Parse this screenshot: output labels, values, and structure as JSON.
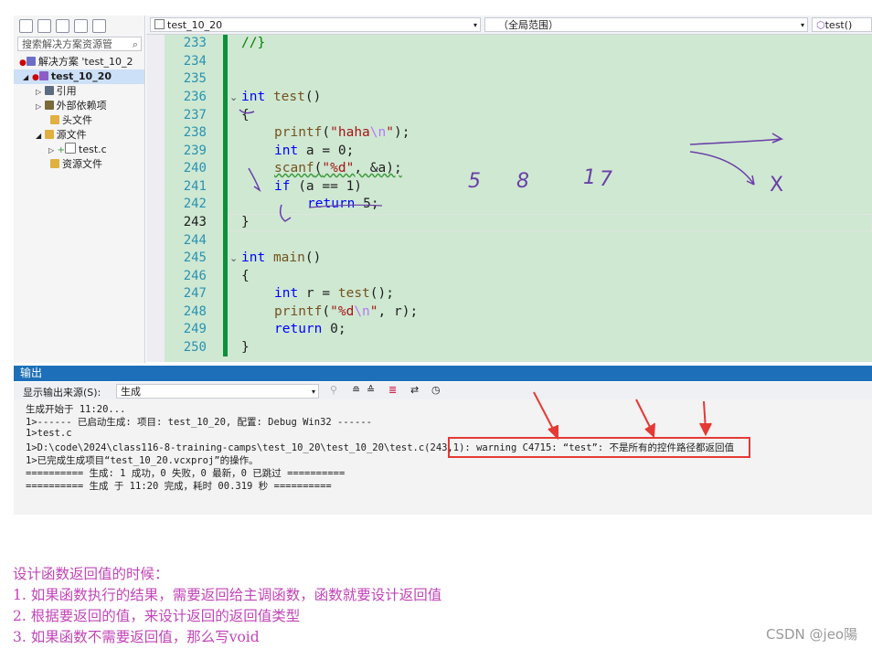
{
  "solution_explorer": {
    "search_placeholder": "搜索解决方案资源管",
    "tree": [
      {
        "label": "解决方案 'test_10_2",
        "indent": 1
      },
      {
        "label": "test_10_20",
        "indent": 1,
        "selected": true
      },
      {
        "label": "引用",
        "indent": 3
      },
      {
        "label": "外部依赖项",
        "indent": 3
      },
      {
        "label": "头文件",
        "indent": 3
      },
      {
        "label": "源文件",
        "indent": 3
      },
      {
        "label": "test.c",
        "indent": 5
      },
      {
        "label": "资源文件",
        "indent": 3
      }
    ]
  },
  "editor": {
    "file_dropdown": "test_10_20",
    "scope_dropdown": "（全局范围）",
    "member_dropdown": "test()",
    "line_numbers": [
      "233",
      "234",
      "235",
      "236",
      "237",
      "238",
      "239",
      "240",
      "241",
      "242",
      "243",
      "244",
      "245",
      "246",
      "247",
      "248",
      "249",
      "250"
    ],
    "current_line": "243",
    "code": {
      "l233": "//}",
      "l236_kw": "int",
      "l236_fn": "test",
      "l236_rest": "()",
      "l237": "{",
      "l238_fn": "printf",
      "l238_open": "(",
      "l238_str": "\"haha",
      "l238_esc": "\\n",
      "l238_str2": "\"",
      "l238_close": ");",
      "l239_kw": "int",
      "l239_rest": " a = 0;",
      "l240_fn": "scanf",
      "l240_open": "(",
      "l240_str": "\"%d\"",
      "l240_rest": ", &a);",
      "l241_kw": "if",
      "l241_rest": " (a == 1)",
      "l242_kw": "return",
      "l242_rest": " 5;",
      "l243": "}",
      "l245_kw": "int",
      "l245_fn": "main",
      "l245_rest": "()",
      "l246": "{",
      "l247_kw": "int",
      "l247_mid": " r = ",
      "l247_fn": "test",
      "l247_rest": "();",
      "l248_fn": "printf",
      "l248_open": "(",
      "l248_str": "\"%d",
      "l248_esc": "\\n",
      "l248_str2": "\"",
      "l248_rest": ", r);",
      "l249_kw": "return",
      "l249_rest": " 0;",
      "l250": "}"
    }
  },
  "output": {
    "title": "输出",
    "source_label": "显示输出来源(S):",
    "source_value": "生成",
    "lines": [
      "生成开始于 11:20...",
      "1>------ 已启动生成: 项目: test_10_20, 配置: Debug Win32 ------",
      "1>test.c",
      "1>D:\\code\\2024\\class116-8-training-camps\\test_10_20\\test_10_20\\test.c(243,1): warning C4715: “test”: 不是所有的控件路径都返回值",
      "1>已完成生成项目“test_10_20.vcxproj”的操作。",
      "========== 生成: 1 成功，0 失败，0 最新，0 已跳过 ==========",
      "========== 生成 于 11:20 完成，耗时 00.319 秒 =========="
    ]
  },
  "annotations": {
    "handwritten": [
      "5",
      "8",
      "1",
      "7",
      "X"
    ]
  },
  "notes": {
    "heading": "设计函数返回值的时候：",
    "items": [
      "1. 如果函数执行的结果，需要返回给主调函数，函数就要设计返回值",
      "2. 根据要返回的值，来设计返回的返回值类型",
      "3. 如果函数不需要返回值，那么写void"
    ]
  },
  "watermark": "CSDN @jeo陽",
  "colors": {
    "editor_bg": "#cfe8d2",
    "change_bar": "#0d8f3c",
    "output_title": "#1c6fb8",
    "warning_box": "#e53935",
    "note_text": "#c145b7"
  }
}
